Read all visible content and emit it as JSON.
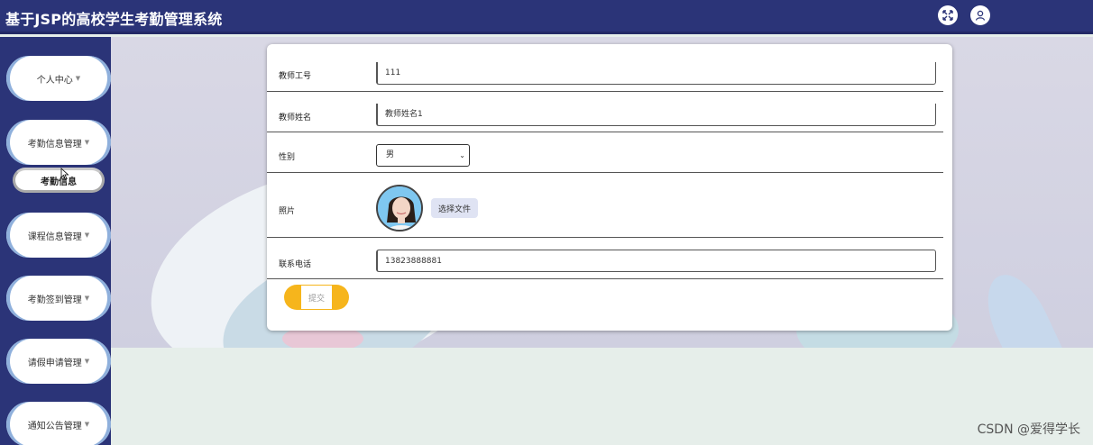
{
  "header": {
    "title": "基于JSP的高校学生考勤管理系统",
    "icons": [
      "fullscreen-icon",
      "user-icon"
    ]
  },
  "sidebar": {
    "items": [
      {
        "label": "个人中心"
      },
      {
        "label": "考勤信息管理"
      },
      {
        "label": "课程信息管理"
      },
      {
        "label": "考勤签到管理"
      },
      {
        "label": "请假申请管理"
      },
      {
        "label": "通知公告管理"
      }
    ],
    "active_submenu": "考勤信息"
  },
  "form": {
    "fields": {
      "teacher_id": {
        "label": "教师工号",
        "value": "111"
      },
      "teacher_name": {
        "label": "教师姓名",
        "value": "教师姓名1"
      },
      "gender": {
        "label": "性别",
        "value": "男"
      },
      "photo": {
        "label": "照片",
        "button": "选择文件"
      },
      "phone": {
        "label": "联系电话",
        "value": "13823888881"
      }
    },
    "submit_label": "提交"
  },
  "watermark": "CSDN @爱得学长",
  "colors": {
    "header": "#2b3478",
    "accent": "#f6b51c"
  }
}
